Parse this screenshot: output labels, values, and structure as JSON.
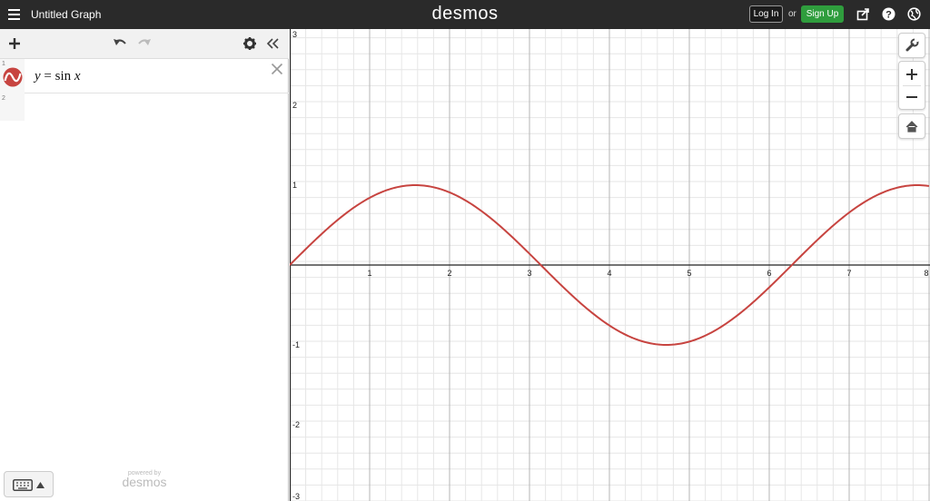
{
  "topbar": {
    "title": "Untitled Graph",
    "logo": "desmos",
    "login_label": "Log In",
    "or_label": "or",
    "signup_label": "Sign Up"
  },
  "expressions": {
    "rows": [
      {
        "number": "1",
        "lhs": "y",
        "equals": "=",
        "func": "sin",
        "arg": "x",
        "color": "#c74440"
      },
      {
        "number": "2"
      }
    ]
  },
  "footer": {
    "powered_by": "powered by",
    "brand": "desmos"
  },
  "graph": {
    "x_ticks": [
      "1",
      "2",
      "3",
      "4",
      "5",
      "6",
      "7",
      "8"
    ],
    "y_ticks": [
      "3",
      "2",
      "1",
      "-1",
      "-2",
      "-3"
    ],
    "curve_color": "#c74440"
  },
  "chart_data": {
    "type": "line",
    "series": [
      {
        "name": "y = sin x",
        "function": "sin(x)",
        "x_range": [
          0,
          8
        ]
      }
    ],
    "xlim": [
      0,
      8
    ],
    "ylim": [
      -3,
      3
    ],
    "xticks": [
      1,
      2,
      3,
      4,
      5,
      6,
      7,
      8
    ],
    "yticks": [
      -3,
      -2,
      -1,
      1,
      2,
      3
    ],
    "grid": true,
    "minor_grid": true
  }
}
